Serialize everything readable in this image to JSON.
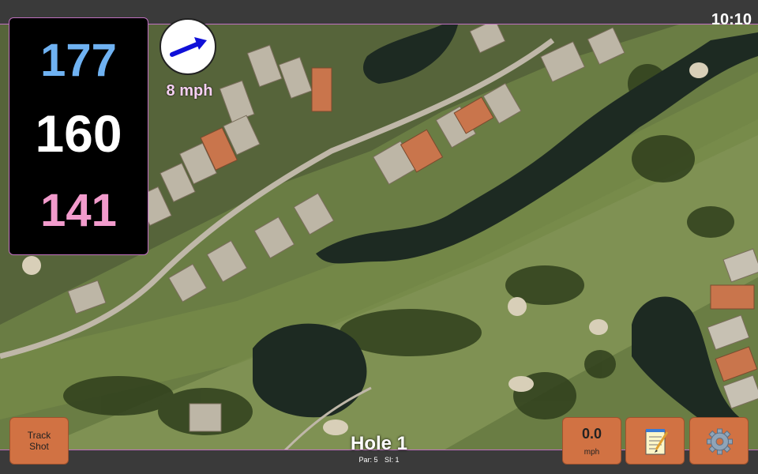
{
  "clock": "10:10",
  "distances": {
    "back": "177",
    "middle": "160",
    "front": "141"
  },
  "wind": {
    "speed": "8 mph"
  },
  "buttons": {
    "track_shot_line1": "Track",
    "track_shot_line2": "Shot",
    "speed_value": "0.0",
    "speed_unit": "mph"
  },
  "hole": {
    "title": "Hole 1",
    "par": "Par: 5",
    "si": "SI: 1"
  },
  "colors": {
    "back": "#6fb2f2",
    "middle": "#ffffff",
    "front": "#f29bcc",
    "button": "#d17243",
    "border": "#c070c0"
  },
  "icons": {
    "wind": "wind-arrow-icon",
    "notes": "notepad-icon",
    "settings": "gear-icon"
  }
}
